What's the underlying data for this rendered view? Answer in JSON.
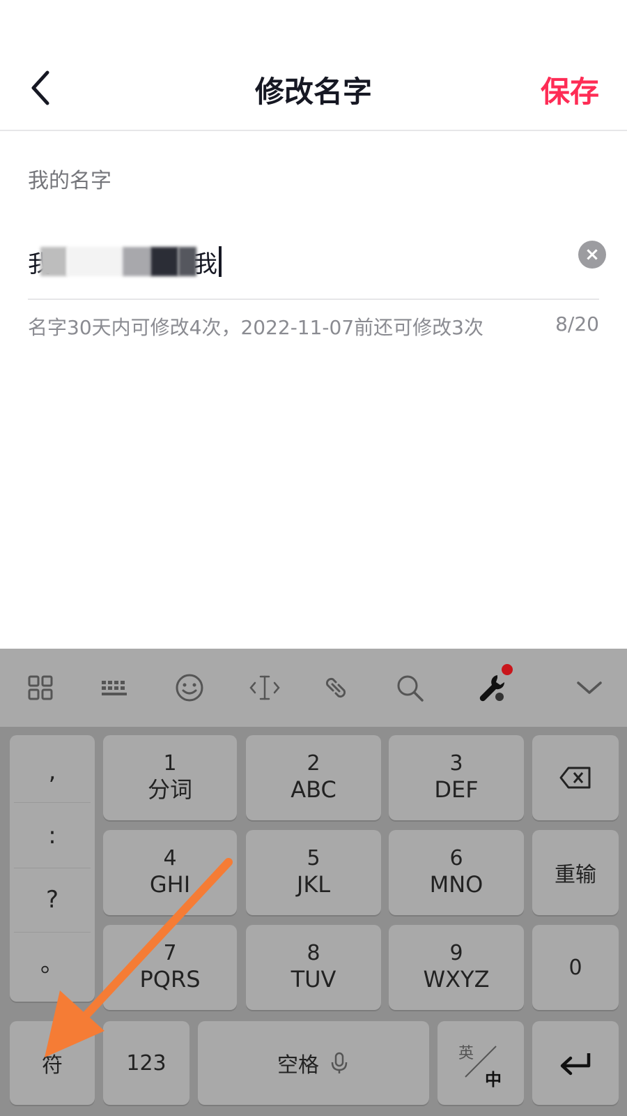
{
  "header": {
    "title": "修改名字",
    "save_label": "保存"
  },
  "form": {
    "label": "我的名字",
    "name_first_char": "我",
    "name_last_char": "我",
    "hint": "名字30天内可修改4次，2022-11-07前还可修改3次",
    "counter": "8/20"
  },
  "keyboard": {
    "toolbar_icons": [
      "apps-grid-icon",
      "keyboard-icon",
      "emoji-icon",
      "cursor-move-icon",
      "link-icon",
      "search-icon",
      "tools-icon",
      "collapse-chevron-icon"
    ],
    "punctuation": [
      ",",
      ":",
      "?",
      "。"
    ],
    "keys": [
      {
        "num": "1",
        "label": "分词"
      },
      {
        "num": "2",
        "label": "ABC"
      },
      {
        "num": "3",
        "label": "DEF"
      },
      {
        "num": "4",
        "label": "GHI"
      },
      {
        "num": "5",
        "label": "JKL"
      },
      {
        "num": "6",
        "label": "MNO"
      },
      {
        "num": "7",
        "label": "PQRS"
      },
      {
        "num": "8",
        "label": "TUV"
      },
      {
        "num": "9",
        "label": "WXYZ"
      }
    ],
    "reenter": "重输",
    "zero": "0",
    "symbol": "符",
    "numeric": "123",
    "space": "空格",
    "lang_en": "英",
    "lang_zh": "中"
  },
  "colors": {
    "accent": "#fe2c55",
    "annotation_arrow": "#f57c35"
  }
}
